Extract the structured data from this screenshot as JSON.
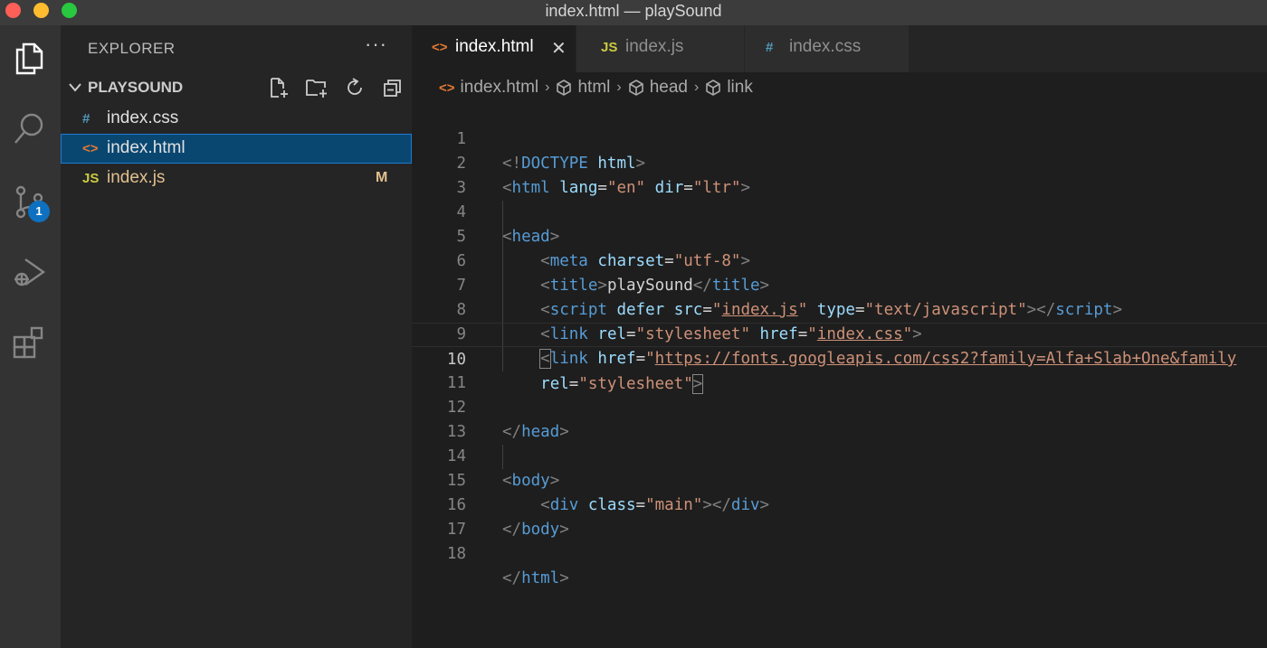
{
  "window": {
    "title": "index.html — playSound"
  },
  "activity_bar": {
    "items": [
      {
        "name": "explorer",
        "icon": "files-icon"
      },
      {
        "name": "search",
        "icon": "search-icon"
      },
      {
        "name": "source-control",
        "icon": "source-control-icon",
        "badge": "1"
      },
      {
        "name": "run-debug",
        "icon": "run-debug-icon"
      },
      {
        "name": "extensions",
        "icon": "extensions-icon"
      }
    ]
  },
  "sidebar": {
    "header": "EXPLORER",
    "more": "···",
    "folder": "PLAYSOUND",
    "files": [
      {
        "icon": "#",
        "name": "index.css",
        "status": ""
      },
      {
        "icon": "<>",
        "name": "index.html",
        "status": ""
      },
      {
        "icon": "JS",
        "name": "index.js",
        "status": "M"
      }
    ]
  },
  "tabs": [
    {
      "icon": "<>",
      "label": "index.html",
      "close": "✕"
    },
    {
      "icon": "JS",
      "label": "index.js"
    },
    {
      "icon": "#",
      "label": "index.css"
    }
  ],
  "breadcrumb": {
    "items": [
      "index.html",
      "html",
      "head",
      "link"
    ],
    "separator": "›"
  },
  "code": {
    "line_numbers": [
      "1",
      "2",
      "3",
      "4",
      "5",
      "6",
      "7",
      "8",
      "9",
      "10",
      "11",
      "12",
      "13",
      "14",
      "15",
      "16",
      "17",
      "18"
    ],
    "current_line": 10,
    "l1": {
      "a": "<!",
      "b": "DOCTYPE",
      "c": " ",
      "d": "html",
      "e": ">"
    },
    "l2": {
      "a": "<",
      "b": "html",
      "c": "lang",
      "d": "=",
      "e": "\"en\"",
      "f": "dir",
      "g": "=",
      "h": "\"ltr\"",
      "i": ">"
    },
    "l4": {
      "a": "<",
      "b": "head",
      "c": ">"
    },
    "l5": {
      "a": "<",
      "b": "meta",
      "c": "charset",
      "d": "=",
      "e": "\"utf-8\"",
      "f": ">"
    },
    "l6": {
      "a": "<",
      "b": "title",
      "c": ">",
      "d": "playSound",
      "e": "</",
      "f": "title",
      "g": ">"
    },
    "l7": {
      "a": "<",
      "b": "script",
      "c": "defer",
      "d": "src",
      "e": "=",
      "f": "\"",
      "g": "index.js",
      "h": "\"",
      "i": "type",
      "j": "=",
      "k": "\"text/javascript\"",
      "l": "></",
      "m": "script",
      "n": ">"
    },
    "l8": {
      "a": "<",
      "b": "link",
      "c": "rel",
      "d": "=",
      "e": "\"stylesheet\"",
      "f": "href",
      "g": "=",
      "h": "\"",
      "i": "index.css",
      "j": "\"",
      "k": ">"
    },
    "l9": {
      "a": "<",
      "b": "link",
      "c": "href",
      "d": "=",
      "e": "\"",
      "f": "https://fonts.googleapis.com/css2?family=Alfa+Slab+One&family"
    },
    "l10": {
      "a": "rel",
      "b": "=",
      "c": "\"stylesheet\"",
      "d": ">"
    },
    "l12": {
      "a": "</",
      "b": "head",
      "c": ">"
    },
    "l14": {
      "a": "<",
      "b": "body",
      "c": ">"
    },
    "l15": {
      "a": "<",
      "b": "div",
      "c": "class",
      "d": "=",
      "e": "\"main\"",
      "f": "></",
      "g": "div",
      "h": ">"
    },
    "l16": {
      "a": "</",
      "b": "body",
      "c": ">"
    },
    "l18": {
      "a": "</",
      "b": "html",
      "c": ">"
    }
  },
  "colors": {
    "tag": "#569cd6",
    "attribute": "#9cdcfe",
    "string": "#ce9178",
    "selection": "#094771",
    "badge": "#0e70c0",
    "modified": "#e2c08d"
  }
}
